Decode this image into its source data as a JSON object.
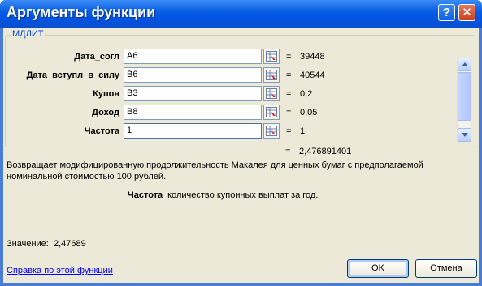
{
  "window": {
    "title": "Аргументы функции",
    "help_label": "?",
    "close_label": "✕"
  },
  "group": {
    "label": "МДЛИТ"
  },
  "args": [
    {
      "label": "Дата_согл",
      "input": "A6",
      "equals": "=",
      "value": "39448"
    },
    {
      "label": "Дата_вступл_в_силу",
      "input": "B6",
      "equals": "=",
      "value": "40544"
    },
    {
      "label": "Купон",
      "input": "B3",
      "equals": "=",
      "value": "0,2"
    },
    {
      "label": "Доход",
      "input": "B8",
      "equals": "=",
      "value": "0,05"
    },
    {
      "label": "Частота",
      "input": "1",
      "equals": "=",
      "value": "1"
    }
  ],
  "result": {
    "equals": "=",
    "value": "2,476891401"
  },
  "description": "Возвращает модифицированную продолжительность Макалея для ценных бумаг с предполагаемой номинальной стоимостью 100 рублей.",
  "param": {
    "name": "Частота",
    "text": "количество купонных выплат за год."
  },
  "value_line": {
    "label": "Значение:",
    "value": "2,47689"
  },
  "help_link": "Справка по этой функции",
  "buttons": {
    "ok": "OK",
    "cancel": "Отмена"
  },
  "icons": {
    "ref": "range-select-icon",
    "scroll_up": "scroll-up-icon",
    "scroll_down": "scroll-down-icon"
  }
}
